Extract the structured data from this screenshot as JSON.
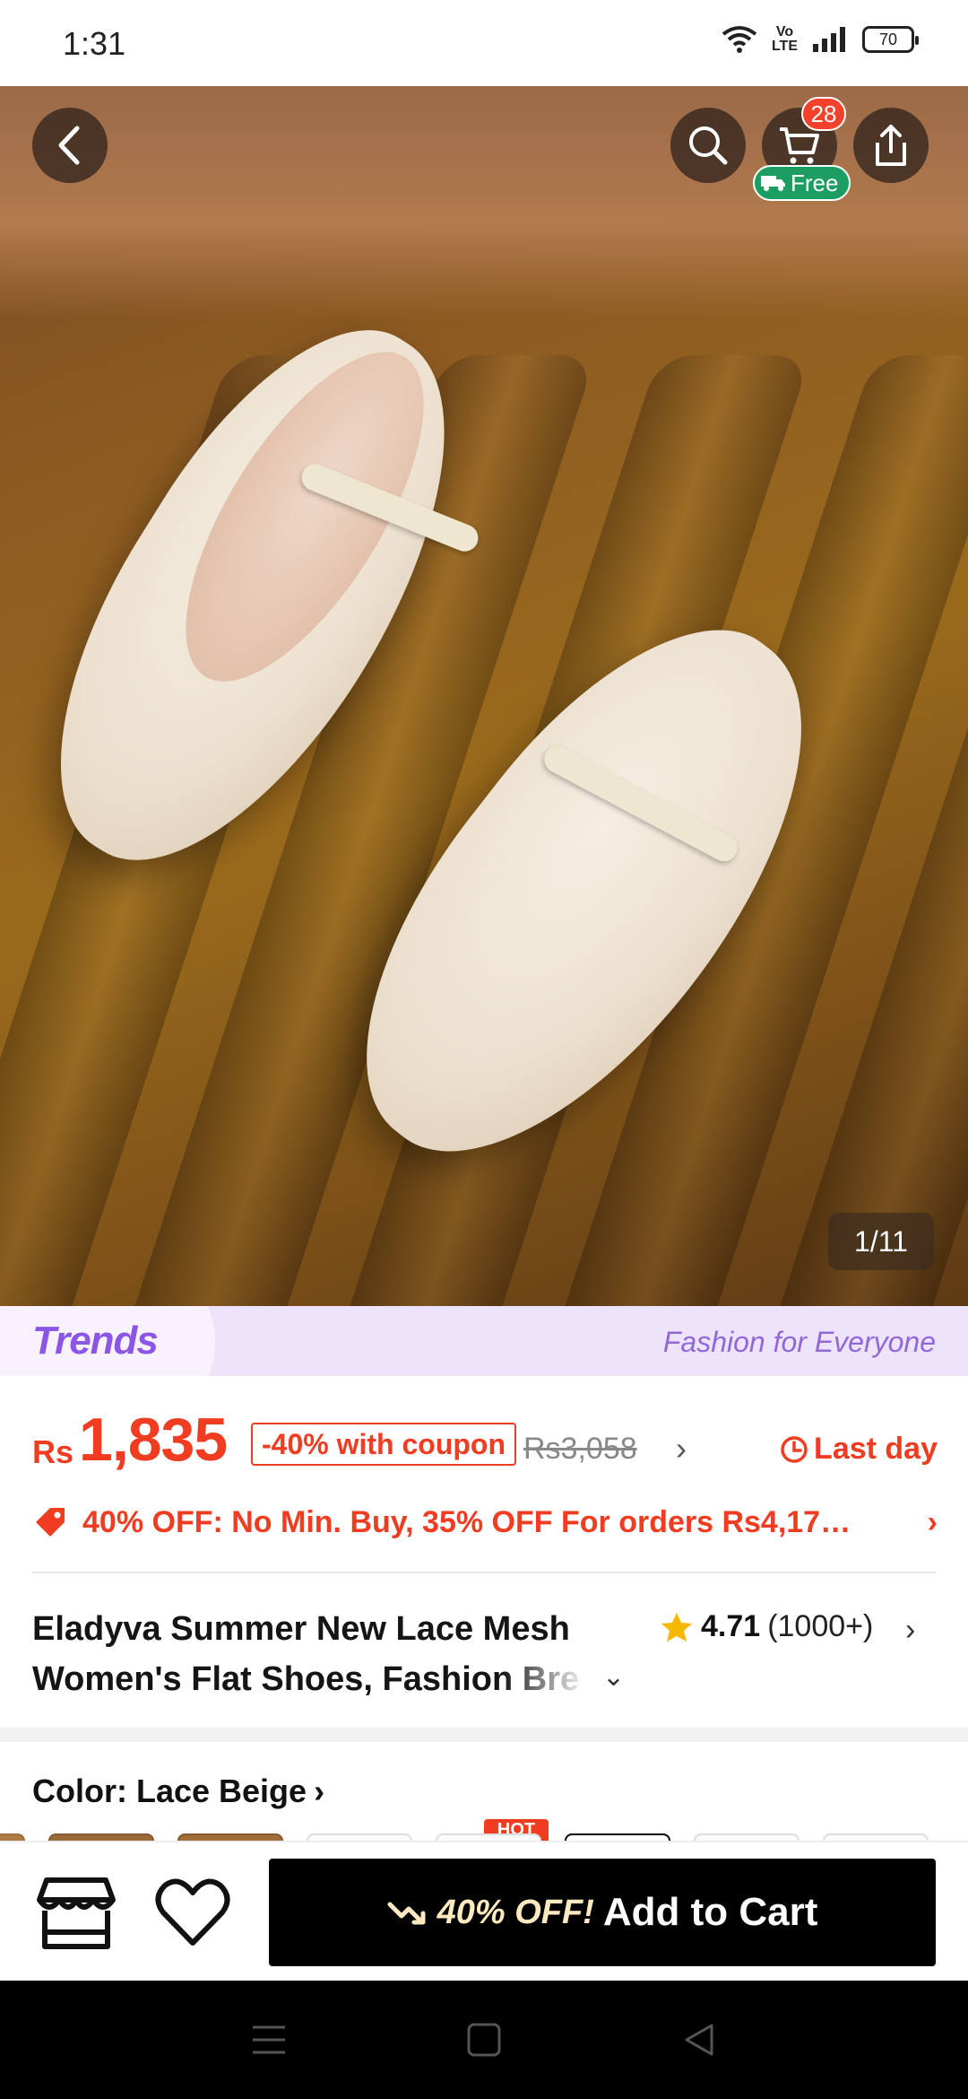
{
  "status_bar": {
    "time": "1:31",
    "battery": "70",
    "volte": "Vo\nLTE"
  },
  "header": {
    "cart_count": "28",
    "free_shipping_label": "Free",
    "image_counter": "1/11"
  },
  "banner": {
    "logo": "Trends",
    "tagline": "Fashion for Everyone"
  },
  "price": {
    "currency": "Rs",
    "value": "1,835",
    "coupon": "-40% with coupon",
    "original": "Rs3,058",
    "urgency": "Last day"
  },
  "promo": {
    "text": "40% OFF: No Min. Buy,  35% OFF For orders Rs4,17…"
  },
  "product": {
    "title_line1": " Eladyva Summer New Lace Mesh",
    "title_line2": "Women's Flat Shoes, Fashion Bre",
    "rating": "4.71",
    "review_count": "(1000+)"
  },
  "variant": {
    "label": "Color: Lace Beige",
    "hot_label": "HOT"
  },
  "action_bar": {
    "discount_label": "40% OFF!",
    "add_to_cart": "Add to Cart"
  },
  "colors": {
    "accent": "#f03c20",
    "free_green": "#1c9e62",
    "trends_purple": "#8b56e6"
  }
}
